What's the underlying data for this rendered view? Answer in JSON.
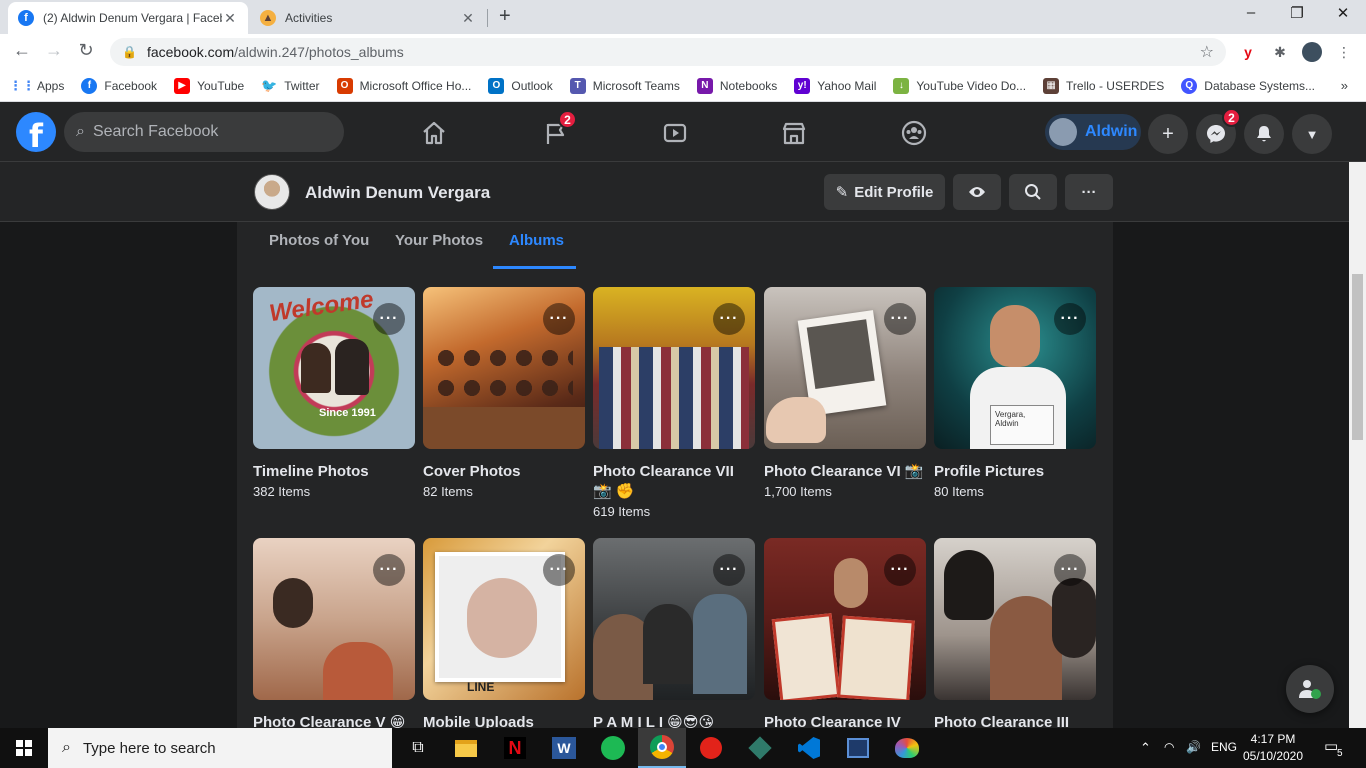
{
  "browser": {
    "tabs": [
      {
        "title": "(2) Aldwin Denum Vergara | Facebook",
        "active": true
      },
      {
        "title": "Activities",
        "active": false
      }
    ],
    "url_domain": "facebook.com",
    "url_path": "/aldwin.247/photos_albums",
    "bookmarks": [
      {
        "label": "Apps",
        "icon": "apps-grid-icon",
        "color": "#4285f4"
      },
      {
        "label": "Facebook",
        "icon": "facebook-icon",
        "color": "#1877f2"
      },
      {
        "label": "YouTube",
        "icon": "youtube-icon",
        "color": "#ff0000"
      },
      {
        "label": "Twitter",
        "icon": "twitter-icon",
        "color": "#1da1f2"
      },
      {
        "label": "Microsoft Office Ho...",
        "icon": "office-icon",
        "color": "#d83b01"
      },
      {
        "label": "Outlook",
        "icon": "outlook-icon",
        "color": "#0072c6"
      },
      {
        "label": "Microsoft Teams",
        "icon": "teams-icon",
        "color": "#5558af"
      },
      {
        "label": "Notebooks",
        "icon": "onenote-icon",
        "color": "#7719aa"
      },
      {
        "label": "Yahoo Mail",
        "icon": "yahoo-icon",
        "color": "#6001d2"
      },
      {
        "label": "YouTube Video Do...",
        "icon": "download-icon",
        "color": "#7cb342"
      },
      {
        "label": "Trello - USERDES",
        "icon": "trello-icon",
        "color": "#5d4037"
      },
      {
        "label": "Database Systems...",
        "icon": "quizlet-icon",
        "color": "#4255ff"
      }
    ]
  },
  "fb": {
    "search_placeholder": "Search Facebook",
    "groups_badge": "2",
    "messenger_badge": "2",
    "profile_short": "Aldwin",
    "profile_name": "Aldwin Denum Vergara",
    "edit_profile": "Edit Profile",
    "subtabs": [
      "Photos of You",
      "Your Photos",
      "Albums"
    ],
    "active_subtab": "Albums",
    "albums": [
      {
        "title": "Timeline Photos",
        "count": "382 Items"
      },
      {
        "title": "Cover Photos",
        "count": "82 Items"
      },
      {
        "title": "Photo Clearance VII 📸 ✊",
        "count": "619 Items"
      },
      {
        "title": "Photo Clearance VI 📸",
        "count": "1,700 Items"
      },
      {
        "title": "Profile Pictures",
        "count": "80 Items"
      },
      {
        "title": "Photo Clearance V 😁",
        "count": ""
      },
      {
        "title": "Mobile Uploads",
        "count": ""
      },
      {
        "title": "P A M I L I 😁😎😘",
        "count": ""
      },
      {
        "title": "Photo Clearance IV",
        "count": ""
      },
      {
        "title": "Photo Clearance III",
        "count": ""
      }
    ]
  },
  "taskbar": {
    "search_placeholder": "Type here to search",
    "lang": "ENG",
    "time": "4:17 PM",
    "date": "05/10/2020",
    "notif_count": "5"
  }
}
